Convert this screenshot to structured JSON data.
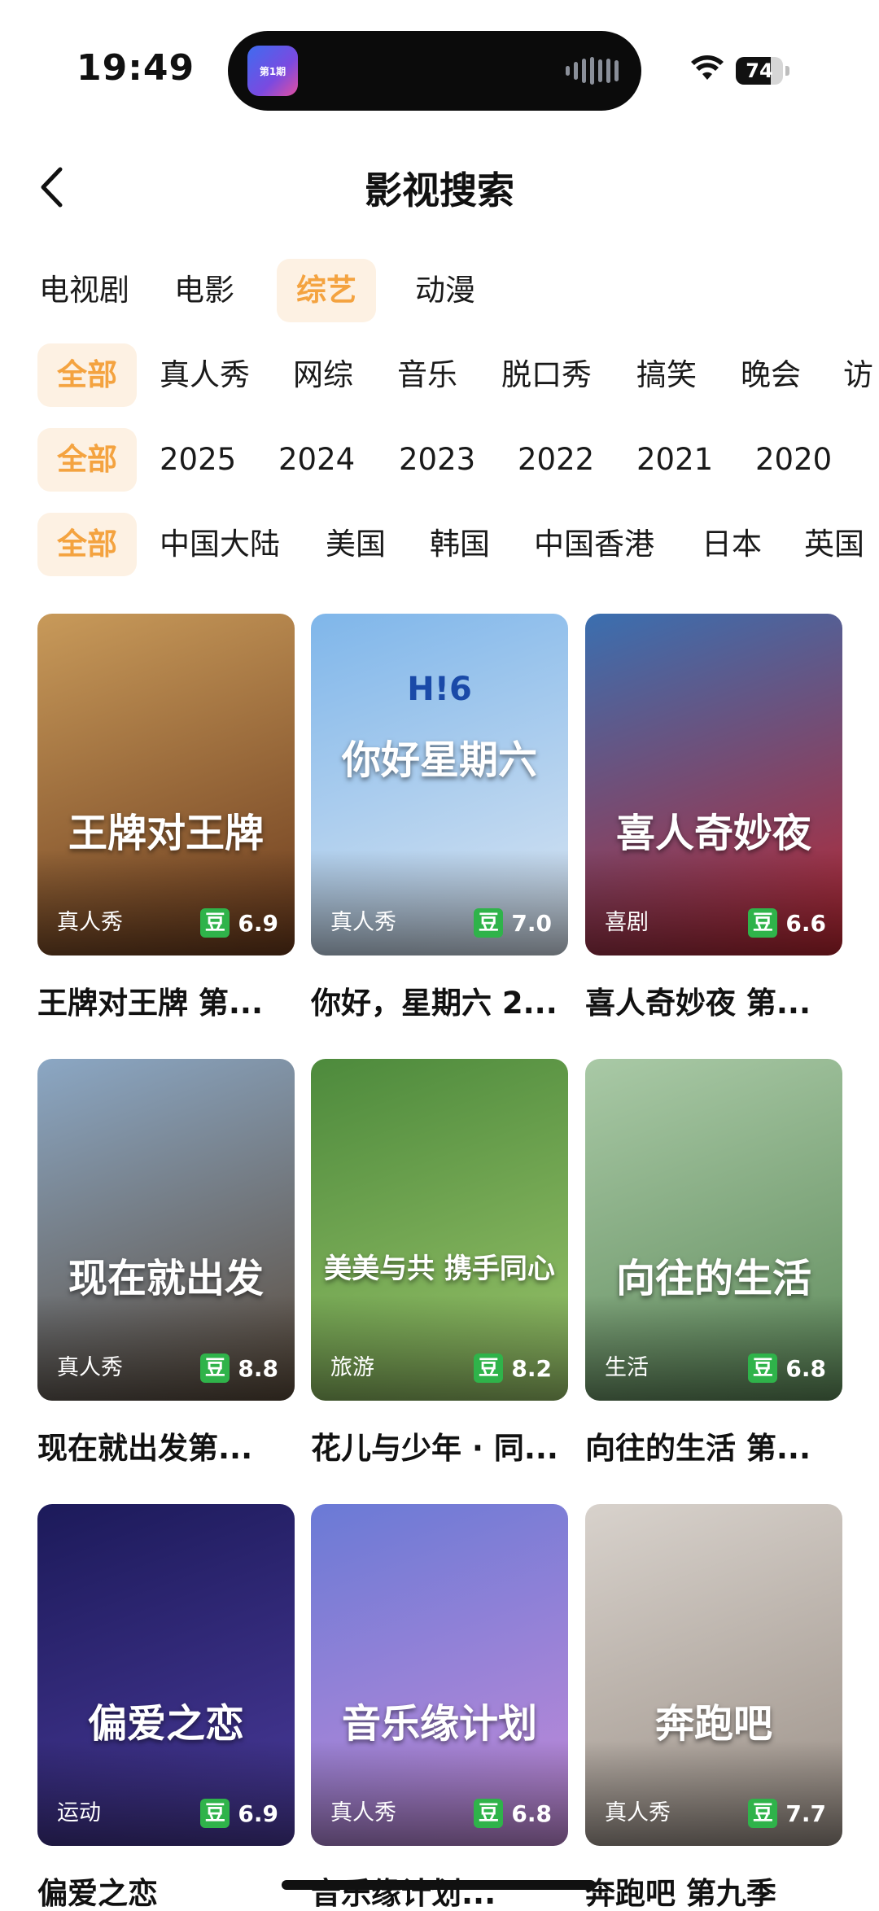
{
  "status": {
    "time": "19:49",
    "battery": "74",
    "battery_level": 0.74,
    "island_app_badge": "第1期"
  },
  "header": {
    "title": "影视搜索"
  },
  "category_tabs": [
    {
      "label": "电视剧",
      "active": false
    },
    {
      "label": "电影",
      "active": false
    },
    {
      "label": "综艺",
      "active": true
    },
    {
      "label": "动漫",
      "active": false
    }
  ],
  "genre_filters": [
    {
      "label": "全部",
      "active": true
    },
    {
      "label": "真人秀"
    },
    {
      "label": "网综"
    },
    {
      "label": "音乐"
    },
    {
      "label": "脱口秀"
    },
    {
      "label": "搞笑"
    },
    {
      "label": "晚会"
    },
    {
      "label": "访"
    }
  ],
  "year_filters": [
    {
      "label": "全部",
      "active": true
    },
    {
      "label": "2025"
    },
    {
      "label": "2024"
    },
    {
      "label": "2023"
    },
    {
      "label": "2022"
    },
    {
      "label": "2021"
    },
    {
      "label": "2020"
    }
  ],
  "region_filters": [
    {
      "label": "全部",
      "active": true
    },
    {
      "label": "中国大陆"
    },
    {
      "label": "美国"
    },
    {
      "label": "韩国"
    },
    {
      "label": "中国香港"
    },
    {
      "label": "日本"
    },
    {
      "label": "英国"
    }
  ],
  "rating_badge": "豆",
  "shows": [
    {
      "title": "王牌对王牌 第...",
      "tag": "真人秀",
      "score": "6.9",
      "poster_text": "王牌对王牌",
      "colors": [
        "#c89a5a",
        "#6b3a1c"
      ]
    },
    {
      "title": "你好，星期六 2...",
      "tag": "真人秀",
      "score": "7.0",
      "poster_text": "你好星期六",
      "poster_badge": "H!6",
      "colors": [
        "#7fb6ea",
        "#dbe6f2"
      ]
    },
    {
      "title": "喜人奇妙夜 第...",
      "tag": "喜剧",
      "score": "6.6",
      "poster_text": "喜人奇妙夜",
      "colors": [
        "#3a6fb0",
        "#b9242e"
      ]
    },
    {
      "title": "现在就出发第...",
      "tag": "真人秀",
      "score": "8.8",
      "poster_text": "现在就出发",
      "colors": [
        "#8ba7c4",
        "#5a4a3a"
      ]
    },
    {
      "title": "花儿与少年 · 同...",
      "tag": "旅游",
      "score": "8.2",
      "poster_text": "美美与共 携手同心",
      "colors": [
        "#4d8a3c",
        "#9ac46a"
      ]
    },
    {
      "title": "向往的生活 第...",
      "tag": "生活",
      "score": "6.8",
      "poster_text": "向往的生活",
      "colors": [
        "#a9c9a6",
        "#5e8a5a"
      ]
    },
    {
      "title": "偏爱之恋",
      "tag": "运动",
      "score": "6.9",
      "poster_text": "偏爱之恋",
      "colors": [
        "#1c1a5a",
        "#4a3a9a"
      ]
    },
    {
      "title": "音乐缘计划...",
      "tag": "真人秀",
      "score": "6.8",
      "poster_text": "音乐缘计划",
      "colors": [
        "#6a7ad6",
        "#c48ad8"
      ]
    },
    {
      "title": "奔跑吧 第九季",
      "tag": "真人秀",
      "score": "7.7",
      "poster_text": "奔跑吧",
      "colors": [
        "#d8d2cc",
        "#9a8f86"
      ]
    }
  ]
}
